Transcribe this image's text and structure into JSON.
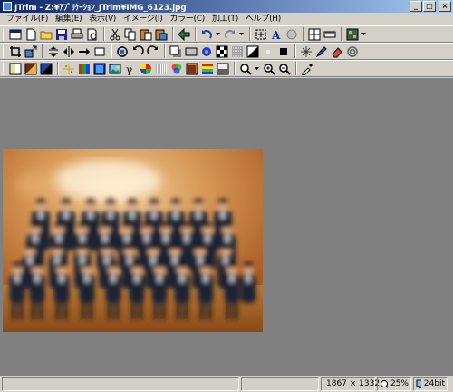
{
  "window": {
    "title": "JTrim - Z:¥ｱﾌﾟﾘｹｰｼｮﾝ_JTrim¥IMG_6123.jpg",
    "minimize": "_",
    "maximize": "□",
    "close": "×"
  },
  "menu": [
    "ファイル(F)",
    "編集(E)",
    "表示(V)",
    "イメージ(I)",
    "カラー(C)",
    "加工(T)",
    "ヘルプ(H)"
  ],
  "status": {
    "dimensions": "1867 × 1332",
    "zoom": "25%",
    "depth": "24bit"
  },
  "colors": {
    "workspace": "#808080",
    "chrome": "#d4d0c8",
    "title_start": "#0a246a",
    "title_end": "#a6caf0",
    "photo_floor": "#b06a2a",
    "photo_wall": "#d89a58",
    "suit": "#1e2233"
  }
}
